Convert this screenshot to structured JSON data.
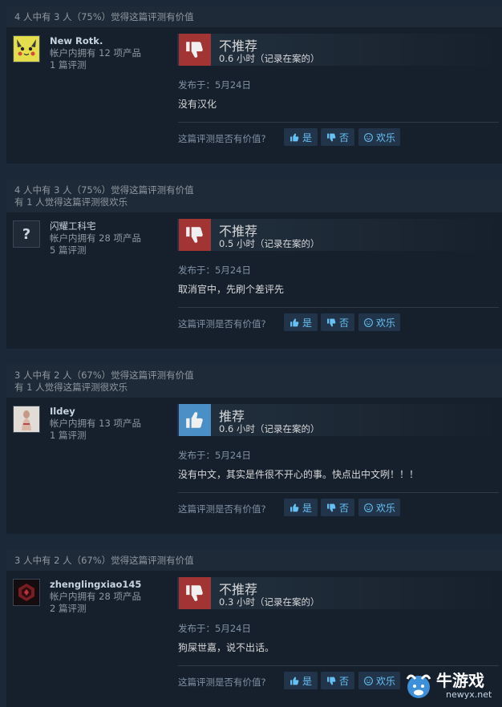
{
  "reviews": [
    {
      "helpful_summary": "4 人中有 3 人（75%）觉得这篇评测有价值",
      "funny_summary": "",
      "author": "New Rotk.",
      "products": "帐户内拥有 12 项产品",
      "review_count": "1 篇评测",
      "verdict": "不推荐",
      "hours": "0.6 小时（记录在案的）",
      "posted": "发布于：5月24日",
      "text": "没有汉化",
      "helpful_q": "这篇评测是否有价值?",
      "yes": "是",
      "no": "否",
      "funny": "欢乐"
    },
    {
      "helpful_summary": "4 人中有 3 人（75%）觉得这篇评测有价值",
      "funny_summary": "有 1 人觉得这篇评测很欢乐",
      "author": "闪耀工科宅",
      "products": "帐户内拥有 28 项产品",
      "review_count": "5 篇评测",
      "verdict": "不推荐",
      "hours": "0.5 小时（记录在案的）",
      "posted": "发布于：5月24日",
      "text": "取消官中，先刷个差评先",
      "helpful_q": "这篇评测是否有价值?",
      "yes": "是",
      "no": "否",
      "funny": "欢乐"
    },
    {
      "helpful_summary": "3 人中有 2 人（67%）觉得这篇评测有价值",
      "funny_summary": "有 1 人觉得这篇评测很欢乐",
      "author": "Ildey",
      "products": "帐户内拥有 13 项产品",
      "review_count": "1 篇评测",
      "verdict": "推荐",
      "hours": "0.6 小时（记录在案的）",
      "posted": "发布于：5月24日",
      "text": "没有中文，其实是件很不开心的事。快点出中文咧！！！",
      "helpful_q": "这篇评测是否有价值?",
      "yes": "是",
      "no": "否",
      "funny": "欢乐"
    },
    {
      "helpful_summary": "3 人中有 2 人（67%）觉得这篇评测有价值",
      "funny_summary": "",
      "author": "zhenglingxiao145",
      "products": "帐户内拥有 28 项产品",
      "review_count": "2 篇评测",
      "verdict": "不推荐",
      "hours": "0.3 小时（记录在案的）",
      "posted": "发布于：5月24日",
      "text": "狗屎世嘉，说不出话。",
      "helpful_q": "这篇评测是否有价值?",
      "yes": "是",
      "no": "否",
      "funny": "欢乐"
    }
  ],
  "avatar_placeholder": "?",
  "watermark": {
    "name": "牛游戏",
    "site": "newyx.net"
  }
}
